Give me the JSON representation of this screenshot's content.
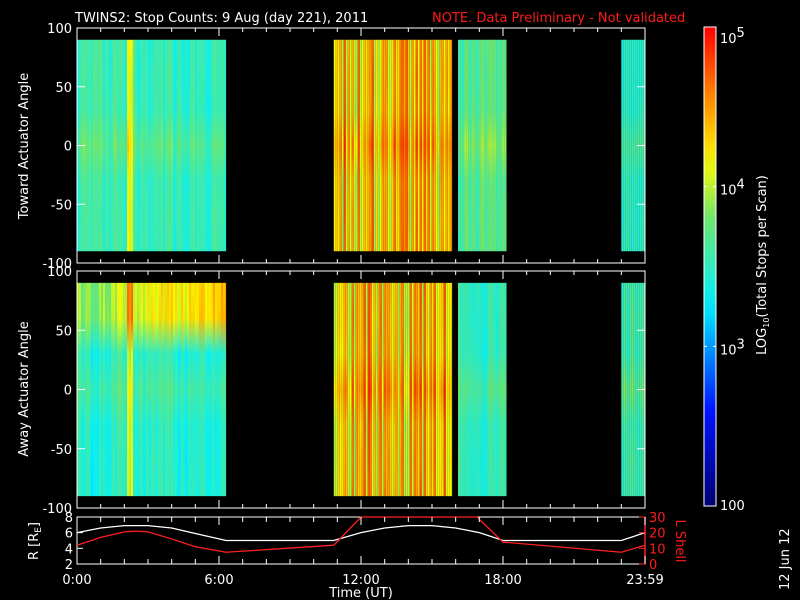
{
  "title": {
    "main": "TWINS2: Stop Counts:  9 Aug (day 221), 2011",
    "note": "NOTE. Data Preliminary - Not validated"
  },
  "colors": {
    "note": "#ff1a1a",
    "r_line": "#ffffff",
    "l_line": "#ff2020"
  },
  "side_date": "12 Jun 12",
  "chart_data": [
    {
      "type": "heatmap",
      "name": "toward",
      "ylabel": "Toward Actuator Angle",
      "ylim": [
        -100,
        100
      ],
      "yticks": [
        "100",
        "50",
        "0",
        "-50",
        "-100"
      ],
      "ytick_values": [
        100,
        50,
        0,
        -50,
        -100
      ],
      "angle_range": [
        -90,
        90
      ],
      "blocks": [
        {
          "start": 0.0,
          "end": 6.3,
          "level": 0.5,
          "var": 0.06,
          "spike": 2.2
        },
        {
          "start": 10.85,
          "end": 15.85,
          "level": 0.78,
          "var": 0.14,
          "spike": null
        },
        {
          "start": 16.1,
          "end": 18.15,
          "level": 0.55,
          "var": 0.05,
          "spike": null
        },
        {
          "start": 23.0,
          "end": 24.0,
          "level": 0.5,
          "var": 0.04,
          "spike": null
        }
      ]
    },
    {
      "type": "heatmap",
      "name": "away",
      "ylabel": "Away Actuator Angle",
      "ylim": [
        -100,
        100
      ],
      "yticks": [
        "100",
        "50",
        "0",
        "-50",
        "-100"
      ],
      "ytick_values": [
        100,
        50,
        0,
        -50,
        -100
      ],
      "angle_range": [
        -90,
        90
      ],
      "blocks": [
        {
          "start": 0.0,
          "end": 6.3,
          "level": 0.48,
          "var": 0.06,
          "spike": 2.2,
          "hot_band": [
            70,
            90
          ]
        },
        {
          "start": 10.85,
          "end": 15.85,
          "level": 0.78,
          "var": 0.14,
          "spike": null
        },
        {
          "start": 16.1,
          "end": 18.15,
          "level": 0.5,
          "var": 0.05,
          "spike": null
        },
        {
          "start": 23.0,
          "end": 24.0,
          "level": 0.52,
          "var": 0.04,
          "spike": null
        }
      ]
    },
    {
      "type": "line",
      "name": "orbit",
      "ylabel_left": "R [R",
      "ylabel_left_sub": "E",
      "ylabel_left_end": "]",
      "ylabel_right": "L Shell",
      "ylim_left": [
        2,
        8
      ],
      "ylim_right": [
        0,
        30
      ],
      "yticks_left": [
        "8",
        "6",
        "4",
        "2"
      ],
      "ytick_values_left": [
        8,
        6,
        4,
        2
      ],
      "yticks_right": [
        "30",
        "20",
        "10",
        "0"
      ],
      "ytick_values_right": [
        30,
        20,
        10,
        0
      ],
      "xlabel": "Time (UT)",
      "xticks": [
        "0:00",
        "6:00",
        "12:00",
        "18:00",
        "23:59"
      ],
      "xtick_values": [
        0,
        6,
        12,
        18,
        24
      ],
      "series": [
        {
          "name": "R",
          "axis": "left",
          "x": [
            0,
            1,
            2,
            3,
            4,
            5,
            6.3,
            10.85,
            12,
            13,
            14,
            15,
            16,
            17,
            18,
            23,
            24
          ],
          "y": [
            6,
            6.6,
            6.9,
            6.9,
            6.6,
            5.9,
            5.0,
            5.0,
            6.0,
            6.6,
            6.9,
            6.9,
            6.6,
            6.0,
            5.0,
            5.0,
            6.0
          ]
        },
        {
          "name": "L Shell",
          "axis": "right",
          "x": [
            0,
            1,
            2,
            2.5,
            3,
            4,
            5,
            6.3,
            10.85,
            12,
            16.9,
            18,
            23,
            24
          ],
          "y": [
            12,
            17,
            20.5,
            21,
            20.5,
            16,
            11,
            7.5,
            12,
            30,
            30,
            14,
            7.5,
            12
          ]
        }
      ]
    },
    {
      "type": "colorbar",
      "label": "LOG",
      "label_sub": "10",
      "label_rest": "(Total Stops per Scan)",
      "ticks": [
        {
          "base": "10",
          "exp": "5",
          "value": 100000
        },
        {
          "base": "10",
          "exp": "4",
          "value": 10000
        },
        {
          "base": "10",
          "exp": "3",
          "value": 1000
        },
        {
          "base": "100",
          "exp": "",
          "value": 100
        }
      ]
    }
  ]
}
